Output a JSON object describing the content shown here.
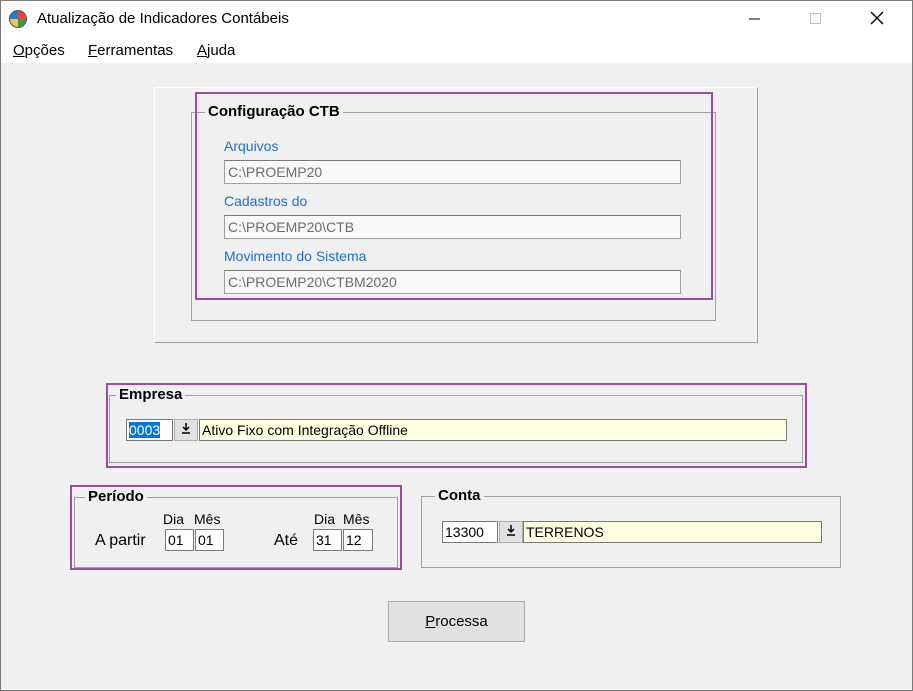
{
  "window": {
    "title": "Atualização de Indicadores Contábeis",
    "minimize_icon": "minimize-icon",
    "maximize_icon": "maximize-icon",
    "close_icon": "close-icon"
  },
  "menu": [
    {
      "accel": "O",
      "rest": "pções"
    },
    {
      "accel": "F",
      "rest": "erramentas"
    },
    {
      "accel": "A",
      "rest": "juda"
    }
  ],
  "config_ctb": {
    "legend": "Configuração CTB",
    "arquivos_label": "Arquivos",
    "arquivos_value": "C:\\PROEMP20",
    "cadastros_label": "Cadastros do",
    "cadastros_value": "C:\\PROEMP20\\CTB",
    "movimento_label": "Movimento do Sistema",
    "movimento_value": "C:\\PROEMP20\\CTBM2020"
  },
  "empresa": {
    "legend": "Empresa",
    "code": "0003",
    "name": "Ativo Fixo com Integração Offline"
  },
  "periodo": {
    "legend": "Período",
    "a_partir_label": "A partir",
    "ate_label": "Até",
    "dia_label": "Dia",
    "mes_label": "Mês",
    "start_dia": "01",
    "start_mes": "01",
    "end_dia": "31",
    "end_mes": "12"
  },
  "conta": {
    "legend": "Conta",
    "code": "13300",
    "name": "TERRENOS"
  },
  "processa": {
    "accel": "P",
    "rest": "rocessa"
  },
  "colors": {
    "highlight": "#9b4ca1",
    "label_blue": "#1f6fd1",
    "field_yellow": "#ffffe1"
  }
}
